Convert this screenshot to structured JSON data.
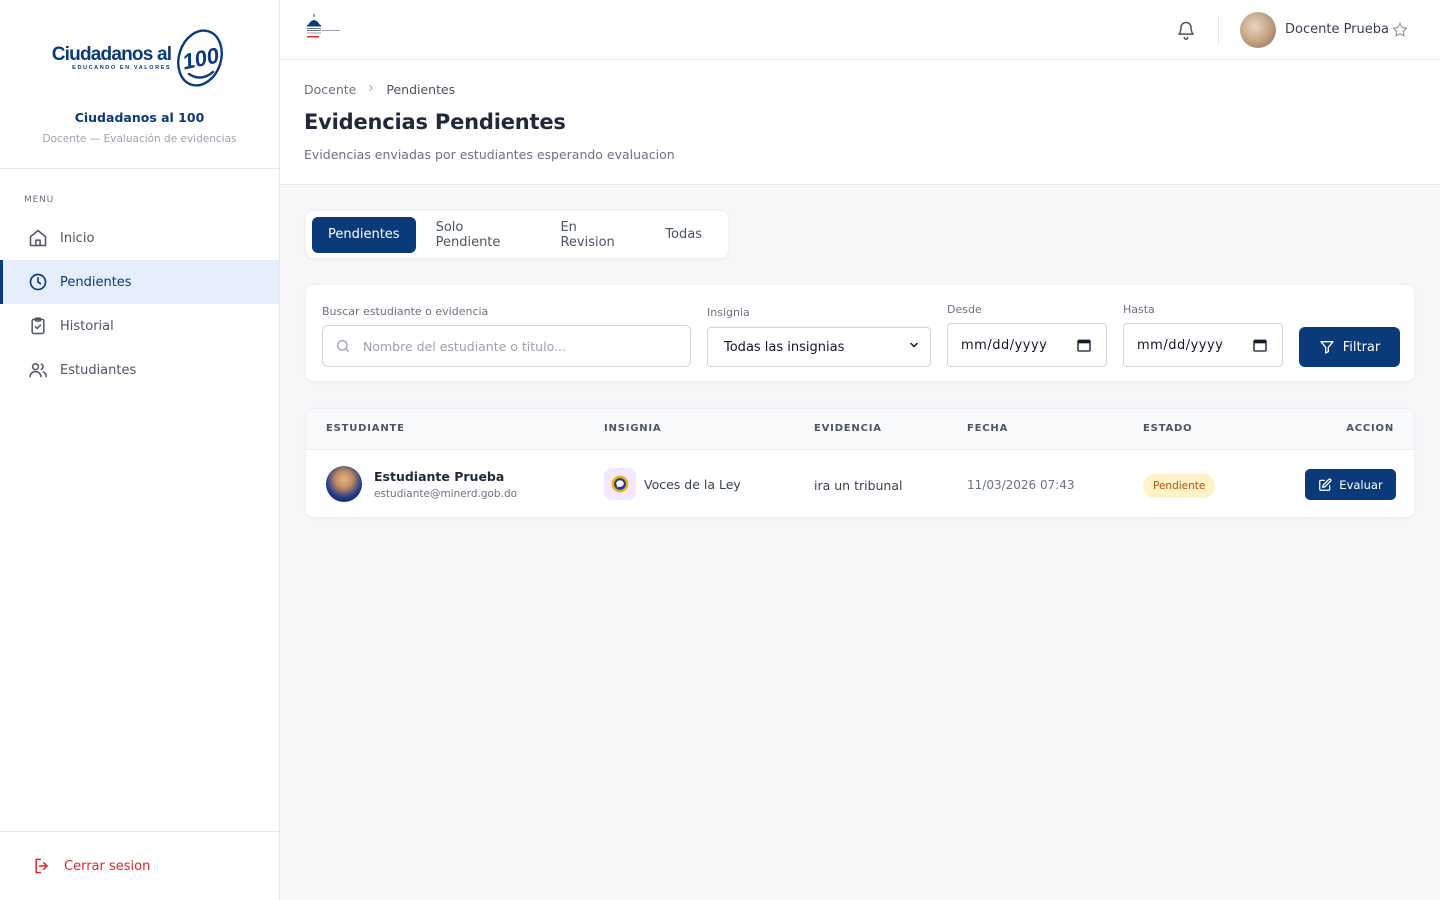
{
  "brand": {
    "logo_main": "Ciudadanos al",
    "logo_sub": "EDUCANDO EN VALORES",
    "logo_number": "100",
    "name": "Ciudadanos al 100",
    "description": "Docente — Evaluación de evidencias"
  },
  "sidebar": {
    "menu_title": "MENU",
    "items": [
      {
        "label": "Inicio",
        "icon": "home-icon",
        "active": false
      },
      {
        "label": "Pendientes",
        "icon": "clock-icon",
        "active": true
      },
      {
        "label": "Historial",
        "icon": "clipboard-check-icon",
        "active": false
      },
      {
        "label": "Estudiantes",
        "icon": "users-icon",
        "active": false
      }
    ],
    "logout": "Cerrar sesion"
  },
  "topbar": {
    "user_name": "Docente Prueba"
  },
  "header": {
    "breadcrumb": [
      "Docente",
      "Pendientes"
    ],
    "title": "Evidencias Pendientes",
    "subtitle": "Evidencias enviadas por estudiantes esperando evaluacion"
  },
  "tabs": [
    {
      "label": "Pendientes",
      "active": true
    },
    {
      "label": "Solo Pendiente",
      "active": false
    },
    {
      "label": "En Revision",
      "active": false
    },
    {
      "label": "Todas",
      "active": false
    }
  ],
  "filters": {
    "search_label": "Buscar estudiante o evidencia",
    "search_placeholder": "Nombre del estudiante o titulo...",
    "insignia_label": "Insignia",
    "insignia_value": "Todas las insignias",
    "desde_label": "Desde",
    "desde_value": "mm/dd/yyyy",
    "hasta_label": "Hasta",
    "hasta_value": "mm/dd/yyyy",
    "button": "Filtrar"
  },
  "table": {
    "columns": [
      "ESTUDIANTE",
      "INSIGNIA",
      "EVIDENCIA",
      "FECHA",
      "ESTADO",
      "ACCION"
    ],
    "rows": [
      {
        "student_name": "Estudiante Prueba",
        "student_email": "estudiante@minerd.gob.do",
        "insignia": "Voces de la Ley",
        "evidencia": "ira un tribunal",
        "fecha": "11/03/2026 07:43",
        "estado": "Pendiente",
        "accion": "Evaluar"
      }
    ]
  },
  "colors": {
    "primary": "#0b3a7a",
    "active_bg": "#e6eefb",
    "danger": "#dc2626",
    "status_bg": "#fef3c7",
    "status_text": "#b45309"
  }
}
